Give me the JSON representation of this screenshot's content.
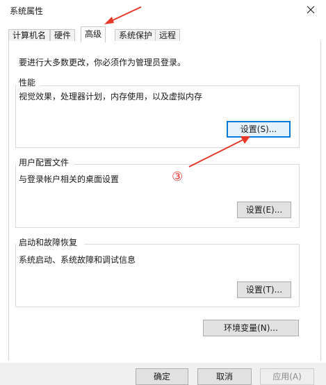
{
  "window": {
    "title": "系统属性"
  },
  "tabs": [
    {
      "label": "计算机名"
    },
    {
      "label": "硬件"
    },
    {
      "label": "高级"
    },
    {
      "label": "系统保护"
    },
    {
      "label": "远程"
    }
  ],
  "admin_note": "要进行大多数更改，你必须作为管理员登录。",
  "performance": {
    "title": "性能",
    "desc": "视觉效果，处理器计划，内存使用，以及虚拟内存",
    "button": "设置(S)..."
  },
  "profiles": {
    "title": "用户配置文件",
    "desc": "与登录帐户相关的桌面设置",
    "button": "设置(E)..."
  },
  "startup": {
    "title": "启动和故障恢复",
    "desc": "系统启动、系统故障和调试信息",
    "button": "设置(T)..."
  },
  "env_button": "环境变量(N)...",
  "footer": {
    "ok": "确定",
    "cancel": "取消",
    "apply": "应用(A)"
  },
  "annotation": {
    "step": "③",
    "color": "#e8372b"
  }
}
